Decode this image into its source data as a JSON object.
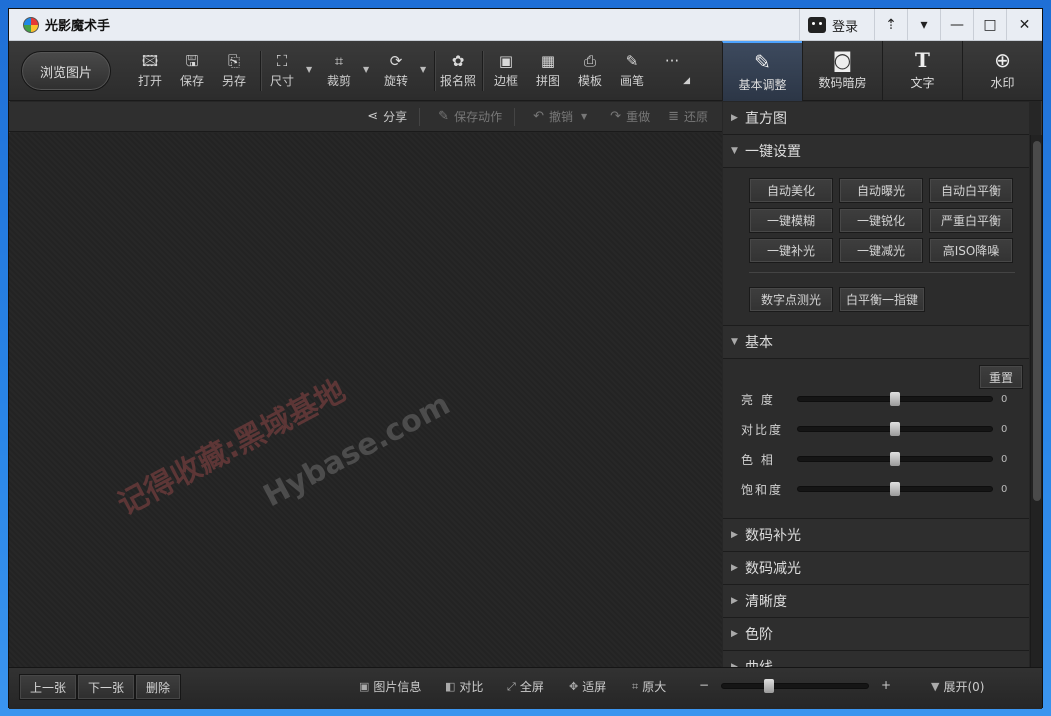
{
  "app": {
    "title": "光影魔术手",
    "login_label": "登录"
  },
  "window_controls": {
    "skin": "⇡",
    "menu": "▾",
    "minimize": "—",
    "maximize": "□",
    "close": "✕"
  },
  "toolbar": {
    "browse_label": "浏览图片",
    "tools": [
      {
        "name": "open",
        "label": "打开",
        "icon": "🖾"
      },
      {
        "name": "save",
        "label": "保存",
        "icon": "🖫"
      },
      {
        "name": "saveas",
        "label": "另存",
        "icon": "⎘"
      },
      {
        "name": "size",
        "label": "尺寸",
        "icon": "⛶"
      },
      {
        "name": "crop",
        "label": "裁剪",
        "icon": "⌗"
      },
      {
        "name": "rotate",
        "label": "旋转",
        "icon": "⟳"
      },
      {
        "name": "idphoto",
        "label": "报名照",
        "icon": "✿"
      },
      {
        "name": "border",
        "label": "边框",
        "icon": "▣"
      },
      {
        "name": "collage",
        "label": "拼图",
        "icon": "▦"
      },
      {
        "name": "template",
        "label": "模板",
        "icon": "⎙"
      },
      {
        "name": "brush",
        "label": "画笔",
        "icon": "✎"
      },
      {
        "name": "more",
        "label": "",
        "icon": "···"
      }
    ],
    "right_tabs": [
      {
        "label": "基本调整",
        "icon": "✎",
        "active": true
      },
      {
        "label": "数码暗房",
        "icon": "◙",
        "active": false
      },
      {
        "label": "文字",
        "icon": "T",
        "active": false
      },
      {
        "label": "水印",
        "icon": "⊕",
        "active": false
      }
    ]
  },
  "subbar": {
    "share": "分享",
    "save_action": "保存动作",
    "undo": "撤销",
    "redo": "重做",
    "restore": "还原"
  },
  "watermark": {
    "line1": "记得收藏:黑域基地",
    "line2": "Hybase.com"
  },
  "panel": {
    "histogram": "直方图",
    "quick_settings": "一键设置",
    "quick_buttons": [
      "自动美化",
      "自动曝光",
      "自动白平衡",
      "一键模糊",
      "一键锐化",
      "严重白平衡",
      "一键补光",
      "一键减光",
      "高ISO降噪"
    ],
    "extra_buttons": [
      "数字点测光",
      "白平衡一指键"
    ],
    "basic": "基本",
    "reset": "重置",
    "sliders": [
      {
        "label": "亮  度",
        "value": 0
      },
      {
        "label": "对比度",
        "value": 0
      },
      {
        "label": "色  相",
        "value": 0
      },
      {
        "label": "饱和度",
        "value": 0
      }
    ],
    "sections": [
      "数码补光",
      "数码减光",
      "清晰度",
      "色阶",
      "曲线"
    ]
  },
  "bottom": {
    "prev": "上一张",
    "next": "下一张",
    "delete": "删除",
    "info": "图片信息",
    "compare": "对比",
    "fullscreen": "全屏",
    "fit": "适屏",
    "original": "原大",
    "zoom_minus": "−",
    "zoom_plus": "+",
    "expand": "展开(0)"
  }
}
